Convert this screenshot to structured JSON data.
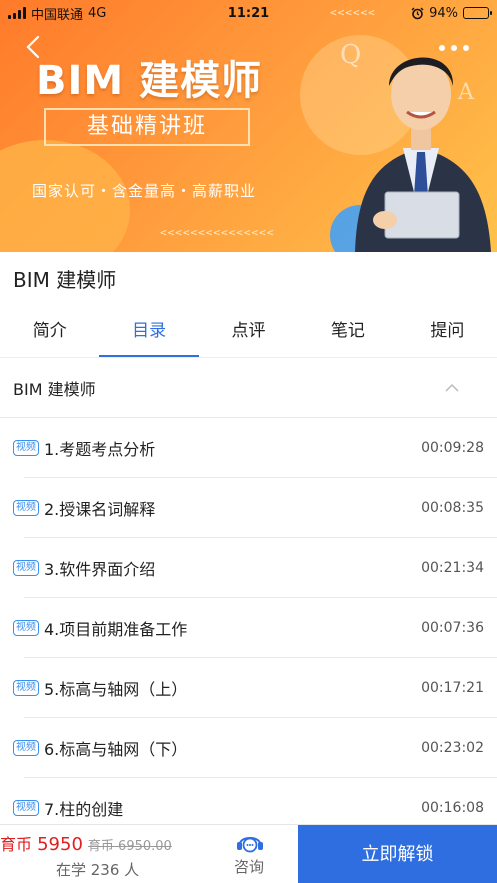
{
  "status_bar": {
    "carrier": "中国联通",
    "network": "4G",
    "time": "11:21",
    "battery": "94%",
    "battery_level": 0.94
  },
  "banner": {
    "title": "BIM 建模师",
    "subtitle": "基础精讲班",
    "tagline": "国家认可・含金量高・高薪职业",
    "deco_letters": [
      "Q",
      "A"
    ],
    "deco_arrows_top": "<<<<<<",
    "deco_arrows_bottom": "<<<<<<<<<<<<<<<"
  },
  "course_title": "BIM 建模师",
  "tabs": [
    {
      "label": "简介",
      "active": false
    },
    {
      "label": "目录",
      "active": true
    },
    {
      "label": "点评",
      "active": false
    },
    {
      "label": "笔记",
      "active": false
    },
    {
      "label": "提问",
      "active": false
    }
  ],
  "chapter": {
    "name": "BIM 建模师"
  },
  "lessons": [
    {
      "badge": "视频",
      "title": "1.考题考点分析",
      "duration": "00:09:28"
    },
    {
      "badge": "视频",
      "title": "2.授课名词解释",
      "duration": "00:08:35"
    },
    {
      "badge": "视频",
      "title": "3.软件界面介绍",
      "duration": "00:21:34"
    },
    {
      "badge": "视频",
      "title": "4.项目前期准备工作",
      "duration": "00:07:36"
    },
    {
      "badge": "视频",
      "title": "5.标高与轴网（上）",
      "duration": "00:17:21"
    },
    {
      "badge": "视频",
      "title": "6.标高与轴网（下）",
      "duration": "00:23:02"
    },
    {
      "badge": "视频",
      "title": "7.柱的创建",
      "duration": "00:16:08"
    }
  ],
  "bottom_bar": {
    "price_prefix": "育币",
    "price_value": "5950",
    "original_price": "育币 6950.00",
    "learners": "在学 236 人",
    "consult_label": "咨询",
    "unlock_label": "立即解锁"
  },
  "colors": {
    "accent": "#2f6fe0",
    "unlock_bg": "#2e6ee0",
    "price": "#e02020",
    "badge": "#3a8ff0",
    "banner_orange": "#ff7a2a"
  }
}
